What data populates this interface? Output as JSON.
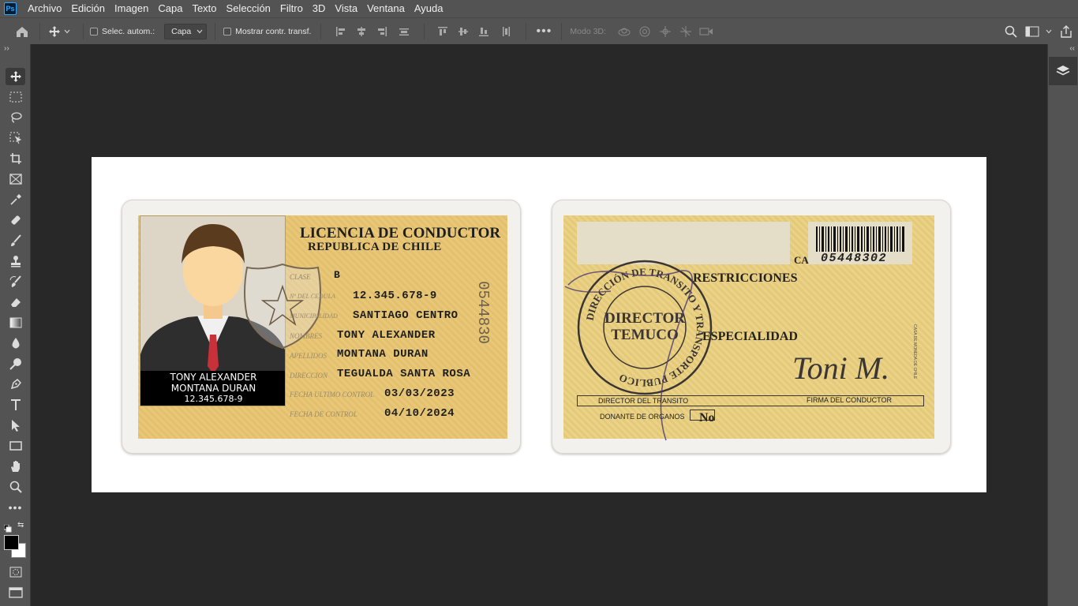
{
  "app": {
    "logo": "Ps"
  },
  "menu": [
    "Archivo",
    "Edición",
    "Imagen",
    "Capa",
    "Texto",
    "Selección",
    "Filtro",
    "3D",
    "Vista",
    "Ventana",
    "Ayuda"
  ],
  "options": {
    "auto_select_label": "Selec. autom.:",
    "auto_select_value": "Capa",
    "show_transform_label": "Mostrar contr. transf.",
    "mode3d_label": "Modo 3D:"
  },
  "front": {
    "title": "LICENCIA DE CONDUCTOR",
    "subtitle": "REPUBLICA DE CHILE",
    "labels": {
      "clase": "CLASE",
      "rut": "Nº DEL CEDULA",
      "municipalidad": "MUNICIPALIDAD",
      "nombres": "NOMBRES",
      "apellidos": "APELLIDOS",
      "direccion": "DIRECCION",
      "ultimo": "FECHA ULTIMO CONTROL",
      "control": "FECHA DE CONTROL"
    },
    "values": {
      "clase": "B",
      "rut": "12.345.678-9",
      "municipalidad": "SANTIAGO CENTRO",
      "nombres": "TONY ALEXANDER",
      "apellidos": "MONTANA DURAN",
      "direccion": "TEGUALDA SANTA ROSA",
      "ultimo": "03/03/2023",
      "control": "04/10/2024"
    },
    "serial": "0544830",
    "photo_caption": [
      "TONY ALEXANDER",
      "MONTANA DURAN",
      "12.345.678-9"
    ]
  },
  "back": {
    "barcode_prefix": "CA",
    "barcode_number": "05448302",
    "stamp_ring": "DIRECCIÓN DE TRANSITO Y TRANSPORTE PUBLICO",
    "stamp_center": [
      "DIRECTOR",
      "TEMUCO"
    ],
    "restricciones": "RESTRICCIONES",
    "especialidad": "ESPECIALIDAD",
    "signature": "Toni M.",
    "director_label": "DIRECTOR DEL TRANSITO",
    "firma_label": "FIRMA DEL CONDUCTOR",
    "donante_label": "DONANTE DE ORGANOS",
    "donante_value": "No",
    "side_text": "CASA DE MONEDA DE CHILE"
  },
  "colors": {
    "chrome": "#535353",
    "workspace": "#282828",
    "card_gold": "#e8c877",
    "tie_red": "#c8303a"
  }
}
